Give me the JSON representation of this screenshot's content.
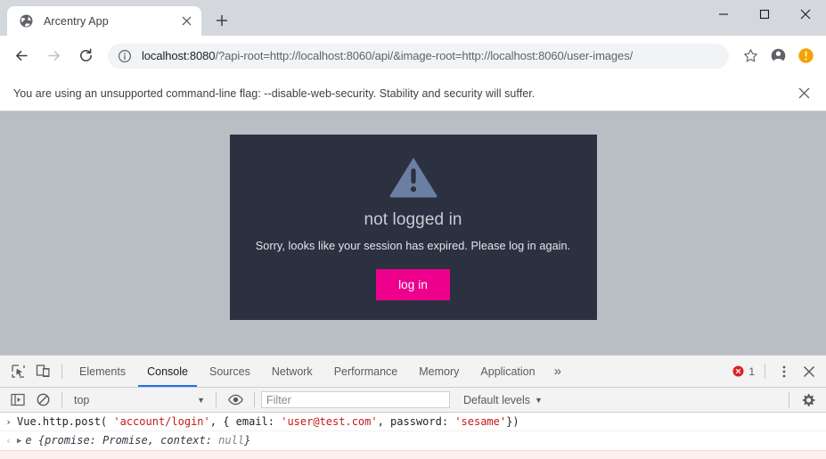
{
  "browser": {
    "tab": {
      "title": "Arcentry App",
      "favicon": "globe-icon",
      "close": "×"
    },
    "new_tab_label": "+",
    "window_controls": {
      "minimize": "—",
      "maximize": "□",
      "close": "✕"
    },
    "nav": {
      "back": "←",
      "forward": "→",
      "reload": "↻"
    },
    "omnibox": {
      "info_icon": "info-circle-icon",
      "url_host": "localhost:8080",
      "url_rest": "/?api-root=http://localhost:8060/api/&image-root=http://localhost:8060/user-images/",
      "full_url": "localhost:8080/?api-root=http://localhost:8060/api/&image-root=http://localhost:8060/user-images/"
    },
    "actions": {
      "bookmark": "star-icon",
      "profile": "account-icon",
      "update": "update-alert-icon"
    },
    "infobar": {
      "message": "You are using an unsupported command-line flag: --disable-web-security. Stability and security will suffer.",
      "close": "✕"
    }
  },
  "page": {
    "background_color": "#b9bdc4",
    "modal": {
      "background_color": "#2b3140",
      "icon": "warning-triangle-icon",
      "icon_color": "#6b7fa3",
      "title": "not logged in",
      "message": "Sorry, looks like your session has expired. Please log in again.",
      "button_label": "log in",
      "button_color": "#ec008c"
    }
  },
  "devtools": {
    "left_icons": [
      {
        "name": "inspect-element-icon"
      },
      {
        "name": "device-toolbar-icon"
      }
    ],
    "tabs": [
      {
        "label": "Elements",
        "active": false
      },
      {
        "label": "Console",
        "active": true
      },
      {
        "label": "Sources",
        "active": false
      },
      {
        "label": "Network",
        "active": false
      },
      {
        "label": "Performance",
        "active": false
      },
      {
        "label": "Memory",
        "active": false
      },
      {
        "label": "Application",
        "active": false
      }
    ],
    "more_tabs": "»",
    "error_count": "1",
    "error_color": "#df2020",
    "menu_icon": "⋮",
    "close_icon": "✕",
    "filterbar": {
      "sidebar_icon": "console-sidebar-icon",
      "clear_icon": "clear-console-icon",
      "context": "top",
      "caret": "▼",
      "eye_icon": "live-expression-icon",
      "filter_placeholder": "Filter",
      "filter_value": "",
      "levels": "Default levels",
      "settings_icon": "gear-icon"
    },
    "console": {
      "input_prompt": "›",
      "output_prompt": "‹",
      "disclosure": "▶",
      "input": {
        "parts": [
          {
            "text": "Vue.http.post( ",
            "type": "plain"
          },
          {
            "text": "'account/login'",
            "type": "string"
          },
          {
            "text": ", { email: ",
            "type": "plain"
          },
          {
            "text": "'user@test.com'",
            "type": "string"
          },
          {
            "text": ", password: ",
            "type": "plain"
          },
          {
            "text": "'sesame'",
            "type": "string"
          },
          {
            "text": "})",
            "type": "plain"
          }
        ],
        "full": "Vue.http.post( 'account/login', { email: 'user@test.com', password: 'sesame'})"
      },
      "output": {
        "parts": [
          {
            "text": "e {promise: Promise, context: ",
            "type": "plain"
          },
          {
            "text": "null",
            "type": "null"
          },
          {
            "text": "}",
            "type": "plain"
          }
        ],
        "full": "e {promise: Promise, context: null}"
      }
    }
  }
}
